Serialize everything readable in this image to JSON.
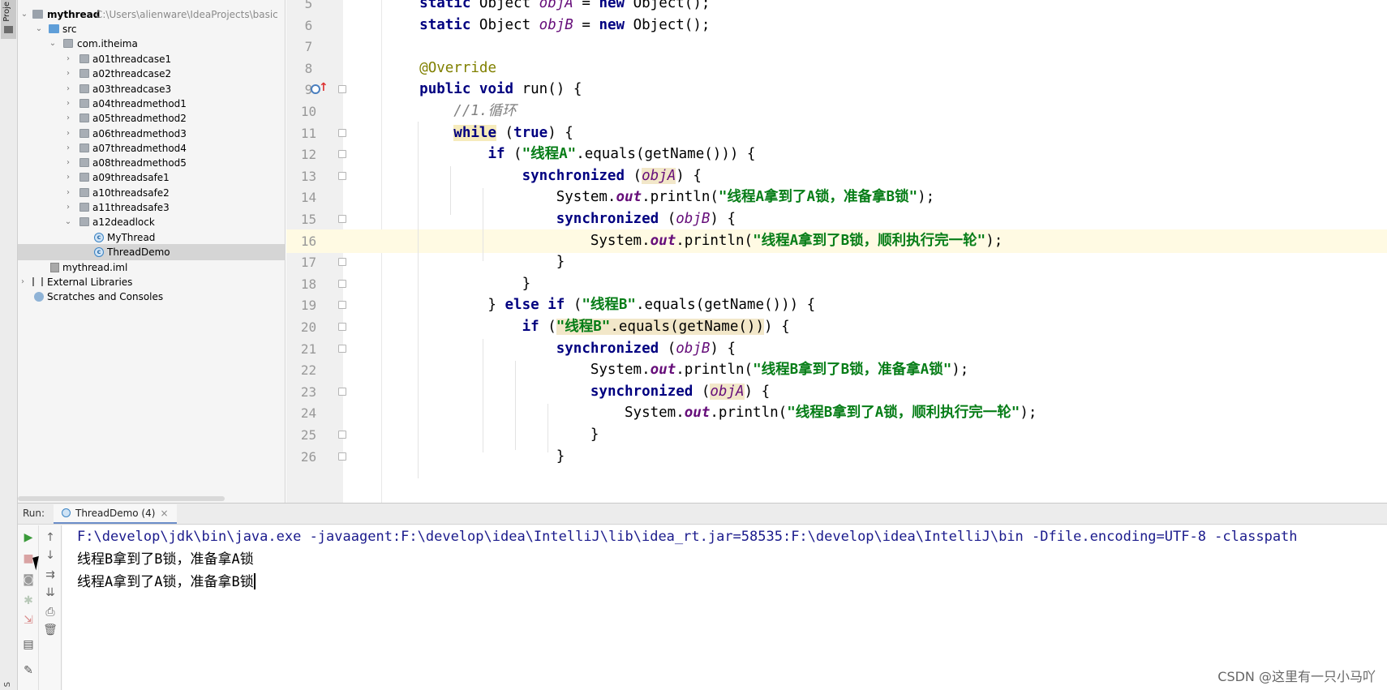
{
  "left_strip": {
    "project_tab": "Proje",
    "bottom_label": "S"
  },
  "project_tree": {
    "root": {
      "name": "mythread",
      "path": "C:\\Users\\alienware\\IdeaProjects\\basic"
    },
    "src": "src",
    "package": "com.itheima",
    "subpackages": [
      "a01threadcase1",
      "a02threadcase2",
      "a03threadcase3",
      "a04threadmethod1",
      "a05threadmethod2",
      "a06threadmethod3",
      "a07threadmethod4",
      "a08threadmethod5",
      "a09threadsafe1",
      "a10threadsafe2",
      "a11threadsafe3",
      "a12deadlock"
    ],
    "classes": [
      "MyThread",
      "ThreadDemo"
    ],
    "selected_class": "ThreadDemo",
    "iml": "mythread.iml",
    "external_libraries": "External Libraries",
    "scratches": "Scratches and Consoles"
  },
  "editor": {
    "line_numbers": [
      "5",
      "6",
      "7",
      "8",
      "9",
      "10",
      "11",
      "12",
      "13",
      "14",
      "15",
      "16",
      "17",
      "18",
      "19",
      "20",
      "21",
      "22",
      "23",
      "24",
      "25",
      "26"
    ],
    "current_line": "16",
    "strings": {
      "s_threadA": "\"线程A\"",
      "s_threadB": "\"线程B\"",
      "msg_a_got_a": "\"线程A拿到了A锁，准备拿B锁\"",
      "msg_a_got_b": "\"线程A拿到了B锁，顺利执行完一轮\"",
      "msg_b_got_b": "\"线程B拿到了B锁，准备拿A锁\"",
      "msg_b_got_a": "\"线程B拿到了A锁，顺利执行完一轮\"",
      "comment_loop": "//1.循环"
    }
  },
  "run_panel": {
    "label": "Run:",
    "tab_title": "ThreadDemo (4)",
    "tab_close": "×",
    "command": "F:\\develop\\jdk\\bin\\java.exe -javaagent:F:\\develop\\idea\\IntelliJ\\lib\\idea_rt.jar=58535:F:\\develop\\idea\\IntelliJ\\bin -Dfile.encoding=UTF-8 -classpath",
    "output": [
      "线程B拿到了B锁，准备拿A锁",
      "线程A拿到了A锁，准备拿B锁"
    ]
  },
  "watermark": "CSDN @这里有一只小马吖",
  "colors": {
    "keyword": "#000080",
    "string": "#067d17",
    "field": "#660e7a",
    "annotation": "#808000",
    "comment": "#808080",
    "current_line_bg": "#fffae3",
    "selection_bg": "#d5d5d5"
  },
  "icons": {
    "run": "play-icon",
    "stop": "stop-icon",
    "up": "arrow-up-icon",
    "down": "arrow-down-icon",
    "wrap": "soft-wrap-icon",
    "scroll_end": "scroll-to-end-icon",
    "print": "print-icon",
    "trash": "trash-icon",
    "camera": "camera-icon",
    "pin": "pin-icon"
  }
}
